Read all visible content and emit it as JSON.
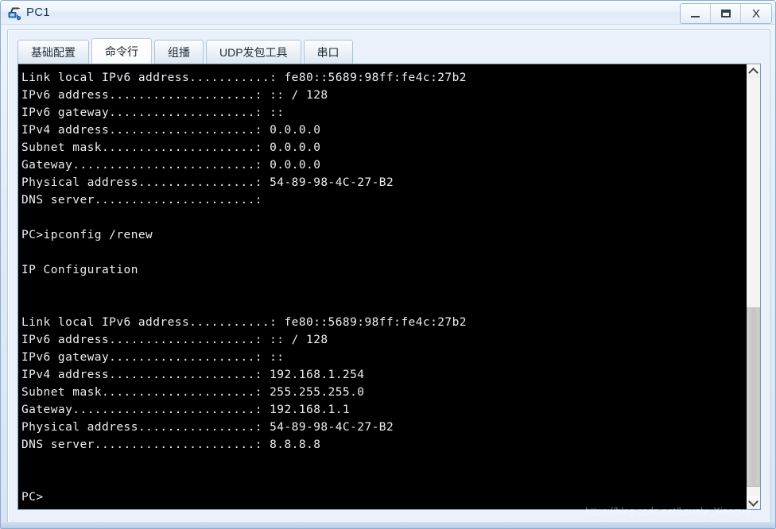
{
  "window": {
    "title": "PC1",
    "icon": "pc-network-icon",
    "controls": {
      "minimize": "minimize-icon",
      "maximize": "maximize-icon",
      "close": "X"
    }
  },
  "tabs": [
    {
      "label": "基础配置",
      "active": false
    },
    {
      "label": "命令行",
      "active": true
    },
    {
      "label": "组播",
      "active": false
    },
    {
      "label": "UDP发包工具",
      "active": false
    },
    {
      "label": "串口",
      "active": false
    }
  ],
  "terminal": {
    "background": "#000000",
    "foreground": "#eceff2",
    "text": "Link local IPv6 address...........: fe80::5689:98ff:fe4c:27b2\nIPv6 address....................: :: / 128\nIPv6 gateway....................: ::\nIPv4 address....................: 0.0.0.0\nSubnet mask.....................: 0.0.0.0\nGateway.........................: 0.0.0.0\nPhysical address................: 54-89-98-4C-27-B2\nDNS server......................:\n\nPC>ipconfig /renew\n\nIP Configuration\n\n\nLink local IPv6 address...........: fe80::5689:98ff:fe4c:27b2\nIPv6 address....................: :: / 128\nIPv6 gateway....................: ::\nIPv4 address....................: 192.168.1.254\nSubnet mask.....................: 255.255.255.0\nGateway.........................: 192.168.1.1\nPhysical address................: 54-89-98-4C-27-B2\nDNS server......................: 8.8.8.8\n\n\nPC>",
    "command_entered": "ipconfig /renew",
    "prompt": "PC>",
    "blocks": [
      {
        "title": "",
        "rows": [
          {
            "label": "Link local IPv6 address",
            "value": "fe80::5689:98ff:fe4c:27b2"
          },
          {
            "label": "IPv6 address",
            "value": ":: / 128"
          },
          {
            "label": "IPv6 gateway",
            "value": "::"
          },
          {
            "label": "IPv4 address",
            "value": "0.0.0.0"
          },
          {
            "label": "Subnet mask",
            "value": "0.0.0.0"
          },
          {
            "label": "Gateway",
            "value": "0.0.0.0"
          },
          {
            "label": "Physical address",
            "value": "54-89-98-4C-27-B2"
          },
          {
            "label": "DNS server",
            "value": ""
          }
        ]
      },
      {
        "title": "IP Configuration",
        "rows": [
          {
            "label": "Link local IPv6 address",
            "value": "fe80::5689:98ff:fe4c:27b2"
          },
          {
            "label": "IPv6 address",
            "value": ":: / 128"
          },
          {
            "label": "IPv6 gateway",
            "value": "::"
          },
          {
            "label": "IPv4 address",
            "value": "192.168.1.254"
          },
          {
            "label": "Subnet mask",
            "value": "255.255.255.0"
          },
          {
            "label": "Gateway",
            "value": "192.168.1.1"
          },
          {
            "label": "Physical address",
            "value": "54-89-98-4C-27-B2"
          },
          {
            "label": "DNS server",
            "value": "8.8.8.8"
          }
        ]
      }
    ]
  },
  "scrollbar": {
    "up_arrow": "chevron-up-icon",
    "down_arrow": "chevron-down-icon",
    "thumb_top_percent": 55,
    "thumb_height_percent": 43
  },
  "watermark": "https://blog.csdn.net/Lovely_Xiaoguo"
}
